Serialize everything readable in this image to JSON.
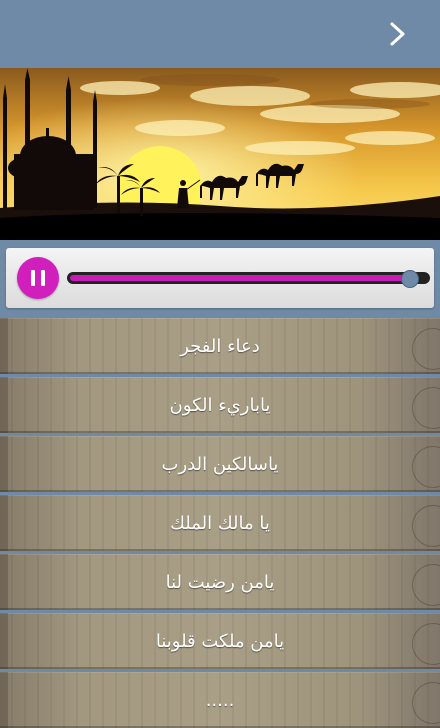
{
  "colors": {
    "header_bg": "#6f8aa6",
    "accent": "#d11fbe",
    "track": "#222222",
    "item_text": "#ffffff"
  },
  "header": {
    "next_icon": "chevron-right-icon"
  },
  "player": {
    "pause_icon": "pause-icon",
    "progress": 0.95
  },
  "playlist": [
    {
      "title": "دعاء الفجر"
    },
    {
      "title": "ياباريء الكون"
    },
    {
      "title": "ياسالكين الدرب"
    },
    {
      "title": "يا مالك الملك"
    },
    {
      "title": "يامن رضيت لنا"
    },
    {
      "title": "يامن ملكت قلوبنا"
    },
    {
      "title": "....."
    }
  ]
}
